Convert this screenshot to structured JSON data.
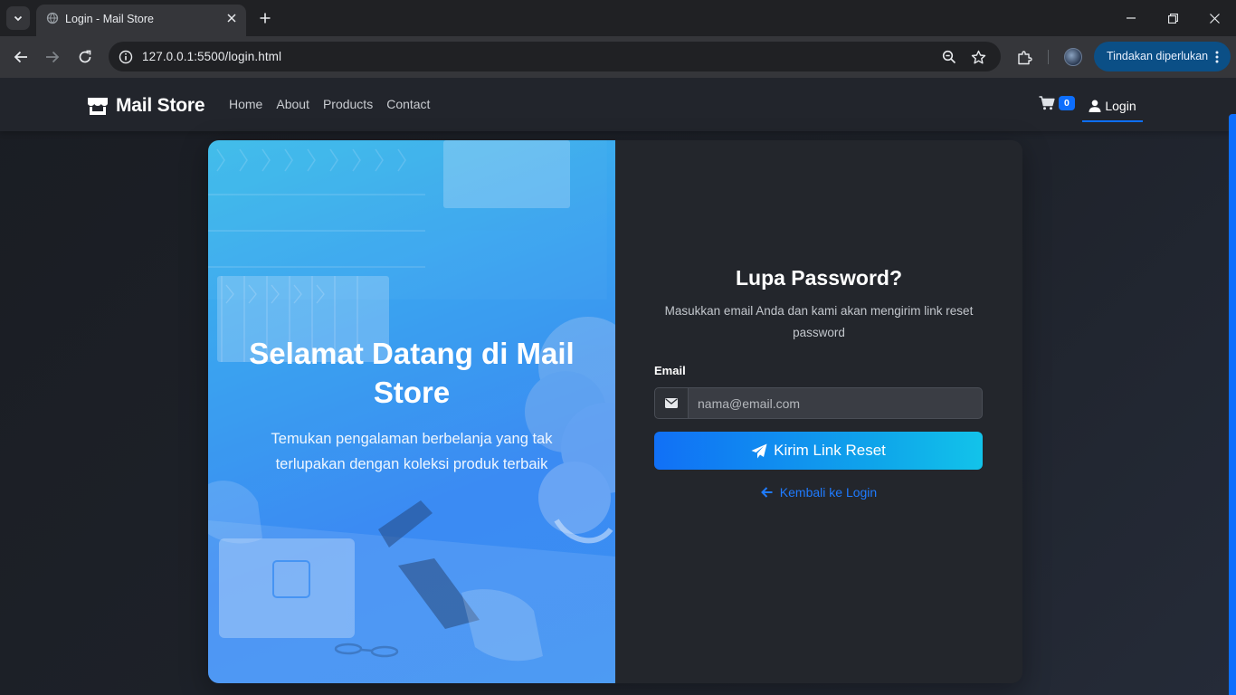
{
  "browser": {
    "tab_title": "Login - Mail Store",
    "url": "127.0.0.1:5500/login.html",
    "action_pill": "Tindakan diperlukan"
  },
  "site_nav": {
    "brand": "Mail Store",
    "links": [
      "Home",
      "About",
      "Products",
      "Contact"
    ],
    "cart_count": "0",
    "login_label": "Login"
  },
  "hero": {
    "title": "Selamat Datang di Mail Store",
    "subtitle": "Temukan pengalaman berbelanja yang tak terlupakan dengan koleksi produk terbaik"
  },
  "form": {
    "title": "Lupa Password?",
    "description": "Masukkan email Anda dan kami akan mengirim link reset password",
    "email_label": "Email",
    "email_placeholder": "nama@email.com",
    "email_value": "",
    "submit_label": "Kirim Link Reset",
    "back_label": "Kembali ke Login"
  },
  "colors": {
    "accent": "#0d6efd",
    "hero_gradient_start": "#3ec8e8",
    "hero_gradient_end": "#3a92f2",
    "panel_bg": "#23262c"
  },
  "icons": {
    "brand": "store-icon",
    "cart": "cart-icon",
    "login": "user-icon",
    "email": "envelope-icon",
    "submit": "paper-plane-icon",
    "back": "arrow-left-icon"
  }
}
